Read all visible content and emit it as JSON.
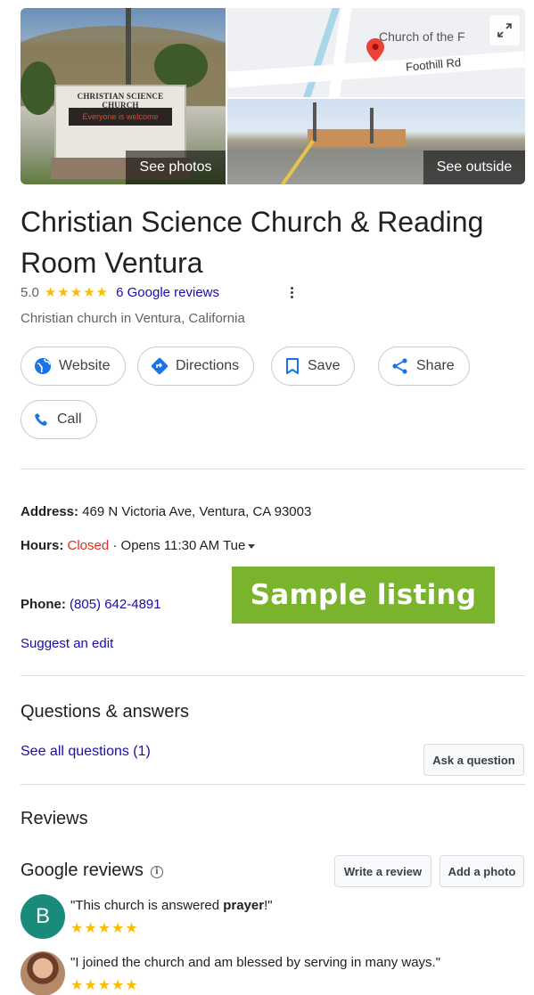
{
  "media": {
    "sign_title": "CHRISTIAN SCIENCE CHURCH",
    "sign_message": "Everyone is welcome",
    "see_photos": "See photos",
    "map_place_label": "Church of the F",
    "map_road_label": "Foothill Rd",
    "see_outside": "See outside"
  },
  "listing": {
    "title": "Christian Science Church & Reading Room Ventura",
    "rating": "5.0",
    "stars": "★★★★★",
    "reviews_link": "6 Google reviews",
    "category": "Christian church in Ventura, California"
  },
  "actions": [
    {
      "label": "Website",
      "icon": "globe-icon"
    },
    {
      "label": "Directions",
      "icon": "directions-icon"
    },
    {
      "label": "Save",
      "icon": "bookmark-icon"
    },
    {
      "label": "Share",
      "icon": "share-icon"
    },
    {
      "label": "Call",
      "icon": "phone-icon"
    }
  ],
  "info": {
    "address_label": "Address:",
    "address_value": "469 N Victoria Ave, Ventura, CA 93003",
    "hours_label": "Hours:",
    "hours_status": "Closed",
    "hours_detail": " · Opens 11:30 AM Tue",
    "phone_label": "Phone:",
    "phone_value": "(805) 642-4891",
    "suggest_edit": "Suggest an edit"
  },
  "badge": "Sample listing",
  "qa": {
    "title": "Questions & answers",
    "see_all": "See all questions (1)",
    "ask_button": "Ask a question"
  },
  "reviews": {
    "title": "Reviews",
    "google_reviews": "Google reviews",
    "write_review": "Write a review",
    "add_photo": "Add a photo",
    "items": [
      {
        "avatar_letter": "B",
        "avatar_color": "#1a8a7a",
        "text_before": "\"This church is answered ",
        "text_bold": "prayer",
        "text_after": "!\"",
        "stars": "★★★★★"
      },
      {
        "avatar_letter": "",
        "text_before": "\"I joined the church and am blessed by serving in many ways.\"",
        "text_bold": "",
        "text_after": "",
        "stars": "★★★★★"
      }
    ]
  },
  "colors": {
    "accent_blue": "#1a73e8",
    "link": "#1a0dab",
    "closed": "#d93025",
    "star": "#fbbc04",
    "badge": "#7ab42c"
  }
}
